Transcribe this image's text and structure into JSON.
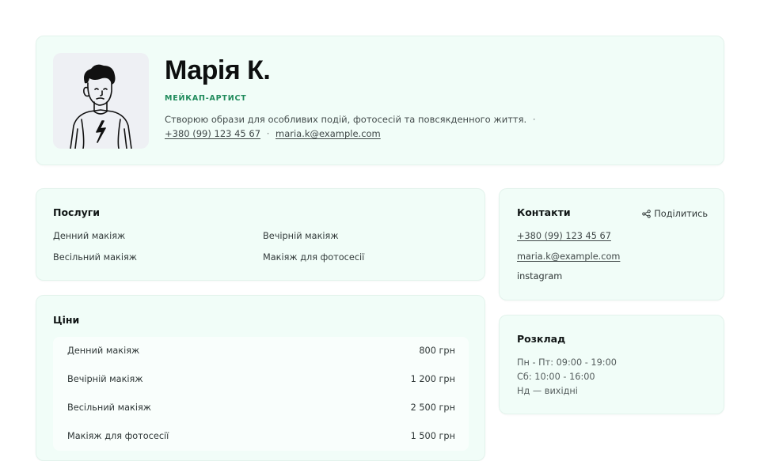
{
  "profile": {
    "name": "Марія К.",
    "role": "МЕЙКАП-АРТИСТ",
    "bio": "Створюю образи для особливих подій, фотосесій та повсякденного життя.",
    "bio_separator": "·",
    "phone": "+380 (99) 123 45 67",
    "email": "maria.k@example.com",
    "link_separator": "·"
  },
  "services": {
    "title": "Послуги",
    "items": [
      "Денний макіяж",
      "Вечірній макіяж",
      "Весільний макіяж",
      "Макіяж для фотосесії"
    ]
  },
  "prices": {
    "title": "Ціни",
    "items": [
      {
        "name": "Денний макіяж",
        "price": "800 грн"
      },
      {
        "name": "Вечірній макіяж",
        "price": "1 200 грн"
      },
      {
        "name": "Весільний макіяж",
        "price": "2 500 грн"
      },
      {
        "name": "Макіяж для фотосесії",
        "price": "1 500 грн"
      }
    ]
  },
  "contacts": {
    "title": "Контакти",
    "share_label": "Поділитись",
    "phone": "+380 (99) 123 45 67",
    "email": "maria.k@example.com",
    "instagram": "instagram"
  },
  "schedule": {
    "title": "Розклад",
    "lines": [
      "Пн - Пт: 09:00 - 19:00",
      "Сб: 10:00 - 16:00",
      "Нд — вихідні"
    ]
  },
  "icons": {
    "share": "share-icon",
    "avatar": "avatar-illustration"
  },
  "colors": {
    "card_bg": "#f1fdf8",
    "accent": "#1f8a5b"
  }
}
